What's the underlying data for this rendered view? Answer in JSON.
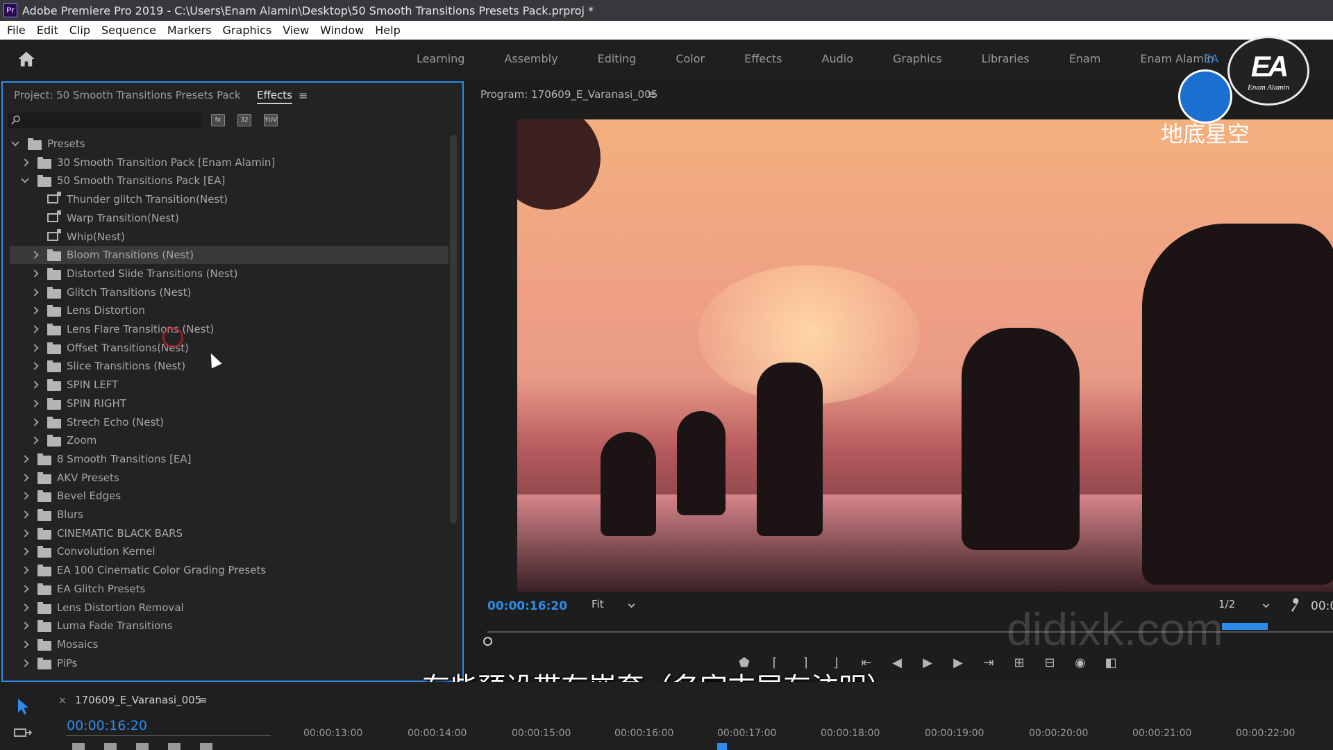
{
  "window": {
    "title": "Adobe Premiere Pro 2019 - C:\\Users\\Enam Alamin\\Desktop\\50 Smooth Transitions Presets Pack.prproj *",
    "logo": "Pr"
  },
  "menu": [
    "File",
    "Edit",
    "Clip",
    "Sequence",
    "Markers",
    "Graphics",
    "View",
    "Window",
    "Help"
  ],
  "workspaces": [
    "Learning",
    "Assembly",
    "Editing",
    "Color",
    "Effects",
    "Audio",
    "Graphics",
    "Libraries",
    "Enam",
    "Enam Alamin"
  ],
  "workspace_extra": "EA",
  "overlay_logo": {
    "big": "EA",
    "small": "Enam Alamin"
  },
  "overlay_brand": "地底星空",
  "left_panel": {
    "project_tab": "Project: 50 Smooth Transitions Presets Pack",
    "effects_tab": "Effects",
    "menu_glyph": "≡",
    "tool_labels": [
      "fx",
      "32",
      "YUV"
    ]
  },
  "tree": [
    {
      "label": "Presets",
      "level": 0,
      "icon": "folder-icon",
      "expanded": true
    },
    {
      "label": "30 Smooth Transition Pack [Enam Alamin]",
      "level": 1,
      "icon": "folder-icon",
      "expanded": false
    },
    {
      "label": "50 Smooth Transitions Pack [EA]",
      "level": 1,
      "icon": "folder-icon",
      "expanded": true
    },
    {
      "label": "Thunder glitch Transition(Nest)",
      "level": 2,
      "icon": "preset-icon"
    },
    {
      "label": "Warp Transition(Nest)",
      "level": 2,
      "icon": "preset-icon"
    },
    {
      "label": "Whip(Nest)",
      "level": 2,
      "icon": "preset-icon"
    },
    {
      "label": "Bloom Transitions (Nest)",
      "level": 2,
      "icon": "folder-icon",
      "expanded": false,
      "selected": true
    },
    {
      "label": "Distorted Slide Transitions (Nest)",
      "level": 2,
      "icon": "folder-icon",
      "expanded": false
    },
    {
      "label": "Glitch Transitions (Nest)",
      "level": 2,
      "icon": "folder-icon",
      "expanded": false
    },
    {
      "label": "Lens Distortion",
      "level": 2,
      "icon": "folder-icon",
      "expanded": false
    },
    {
      "label": "Lens Flare Transitions (Nest)",
      "level": 2,
      "icon": "folder-icon",
      "expanded": false
    },
    {
      "label": "Offset Transitions(Nest)",
      "level": 2,
      "icon": "folder-icon",
      "expanded": false
    },
    {
      "label": "Slice Transitions (Nest)",
      "level": 2,
      "icon": "folder-icon",
      "expanded": false
    },
    {
      "label": "SPIN LEFT",
      "level": 2,
      "icon": "folder-icon",
      "expanded": false
    },
    {
      "label": "SPIN RIGHT",
      "level": 2,
      "icon": "folder-icon",
      "expanded": false
    },
    {
      "label": "Strech Echo (Nest)",
      "level": 2,
      "icon": "folder-icon",
      "expanded": false
    },
    {
      "label": "Zoom",
      "level": 2,
      "icon": "folder-icon",
      "expanded": false
    },
    {
      "label": "8 Smooth Transitions [EA]",
      "level": 1,
      "icon": "folder-icon",
      "expanded": false
    },
    {
      "label": "AKV Presets",
      "level": 1,
      "icon": "folder-icon",
      "expanded": false
    },
    {
      "label": "Bevel Edges",
      "level": 1,
      "icon": "folder-icon",
      "expanded": false
    },
    {
      "label": "Blurs",
      "level": 1,
      "icon": "folder-icon",
      "expanded": false
    },
    {
      "label": "CINEMATIC BLACK BARS",
      "level": 1,
      "icon": "folder-icon",
      "expanded": false
    },
    {
      "label": "Convolution Kernel",
      "level": 1,
      "icon": "folder-icon",
      "expanded": false
    },
    {
      "label": "EA 100 Cinematic Color Grading Presets",
      "level": 1,
      "icon": "folder-icon",
      "expanded": false
    },
    {
      "label": "EA Glitch Presets",
      "level": 1,
      "icon": "folder-icon",
      "expanded": false
    },
    {
      "label": "Lens Distortion Removal",
      "level": 1,
      "icon": "folder-icon",
      "expanded": false
    },
    {
      "label": "Luma Fade Transitions",
      "level": 1,
      "icon": "folder-icon",
      "expanded": false
    },
    {
      "label": "Mosaics",
      "level": 1,
      "icon": "folder-icon",
      "expanded": false
    },
    {
      "label": "PiPs",
      "level": 1,
      "icon": "folder-icon",
      "expanded": false
    }
  ],
  "program": {
    "title": "Program: 170609_E_Varanasi_005",
    "menu_glyph": "≡",
    "timecode": "00:00:16:20",
    "fit": "Fit",
    "resolution": "1/2",
    "timecode_right": "00:0"
  },
  "watermark": "didixk.com",
  "subtitle": "有些预设带有嵌套（名字末尾有注明）",
  "timeline": {
    "close": "×",
    "sequence": "170609_E_Varanasi_005",
    "menu_glyph": "≡",
    "timecode": "00:00:16:20",
    "ticks": [
      "00:00:13:00",
      "00:00:14:00",
      "00:00:15:00",
      "00:00:16:00",
      "00:00:17:00",
      "00:00:18:00",
      "00:00:19:00",
      "00:00:20:00",
      "00:00:21:00",
      "00:00:22:00"
    ]
  },
  "colors": {
    "accent": "#2d8ceb",
    "panel_bg": "#232323",
    "selection": "#3a3a3a"
  }
}
